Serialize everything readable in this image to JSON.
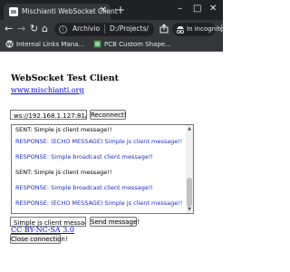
{
  "browser": {
    "tab_title": "Mischianti WebSocket Client",
    "new_tab_symbol": "+",
    "close_tab_symbol": "✕",
    "window_controls": {
      "minimize": "–",
      "maximize": "□",
      "close": "✕"
    },
    "nav": {
      "back": "←",
      "forward": "→",
      "reload": "↻",
      "home": "⌂"
    },
    "address": {
      "scheme_label": "Archivio",
      "url": "D:/Projects/"
    },
    "incognito_label": "In incognito",
    "menu_symbol": "⋮",
    "bookmarks": [
      {
        "label": "Internal Links Mana...",
        "icon": "wordpress-icon"
      },
      {
        "label": "PCB Custom Shape...",
        "icon": "pcb-icon"
      }
    ]
  },
  "page": {
    "title": "WebSocket Test Client",
    "site_link": "www.mischianti.org",
    "server_input": {
      "value": "ws://192.168.1.127:81/"
    },
    "reconnect_label": "Reconnect!",
    "log_lines": [
      {
        "type": "sent",
        "text": "SENT: Simple js client message!!"
      },
      {
        "type": "resp",
        "text": "RESPONSE: (ECHO MESSAGE) Simple js client message!!"
      },
      {
        "type": "resp",
        "text": "RESPONSE: Simple broadcast client message!!"
      },
      {
        "type": "sent",
        "text": "SENT: Simple js client message!!"
      },
      {
        "type": "resp",
        "text": "RESPONSE: Simple broadcast client message!!"
      },
      {
        "type": "resp",
        "text": "RESPONSE: (ECHO MESSAGE) Simple js client message!!"
      }
    ],
    "message_input": {
      "value": "Simple js client message!!"
    },
    "send_label": "Send message!",
    "close_label": "Close connection!",
    "license_link": "CC BY-NC-SA 3.0"
  },
  "colors": {
    "chrome_dark": "#202124",
    "chrome_mid": "#35363a",
    "response_text": "#1b2dca",
    "link": "#0000ee"
  }
}
